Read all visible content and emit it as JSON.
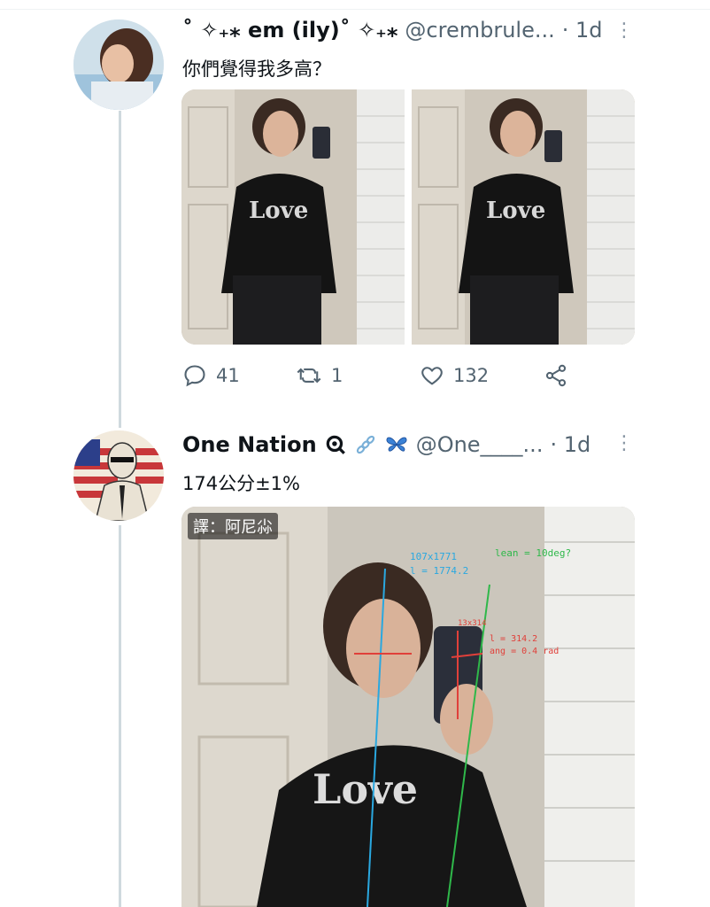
{
  "tweet1": {
    "display_name": "˚ ✧₊⁎ em (ily)˚ ✧₊⁎",
    "handle": "@crembrule...",
    "time": "· 1d",
    "text": "你們覺得我多高？",
    "actions": {
      "replies": "41",
      "retweets": "1",
      "likes": "132"
    }
  },
  "tweet2": {
    "display_name": "One Nation",
    "handle": "@One____...",
    "time": "· 1d",
    "text": "174公分±1%",
    "image": {
      "badge": "譯：阿尼尛",
      "annotations": {
        "blue_box": "107x1771",
        "blue_l": "l = 1774.2",
        "green": "lean = 10deg?",
        "red_box": "13x314",
        "red_l": "l = 314.2",
        "red_ang": "ang = 0.4 rad"
      }
    }
  },
  "icons": [
    "reply-icon",
    "retweet-icon",
    "like-icon",
    "share-icon",
    "more-icon",
    "verified-icon",
    "link-icon",
    "butterfly-icon"
  ],
  "colors": {
    "text": "#0f1419",
    "secondary": "#536471",
    "thread_line": "#cfd9de",
    "measure_blue": "#2aa8e0",
    "measure_green": "#2fb84a",
    "measure_red": "#e0403a"
  }
}
